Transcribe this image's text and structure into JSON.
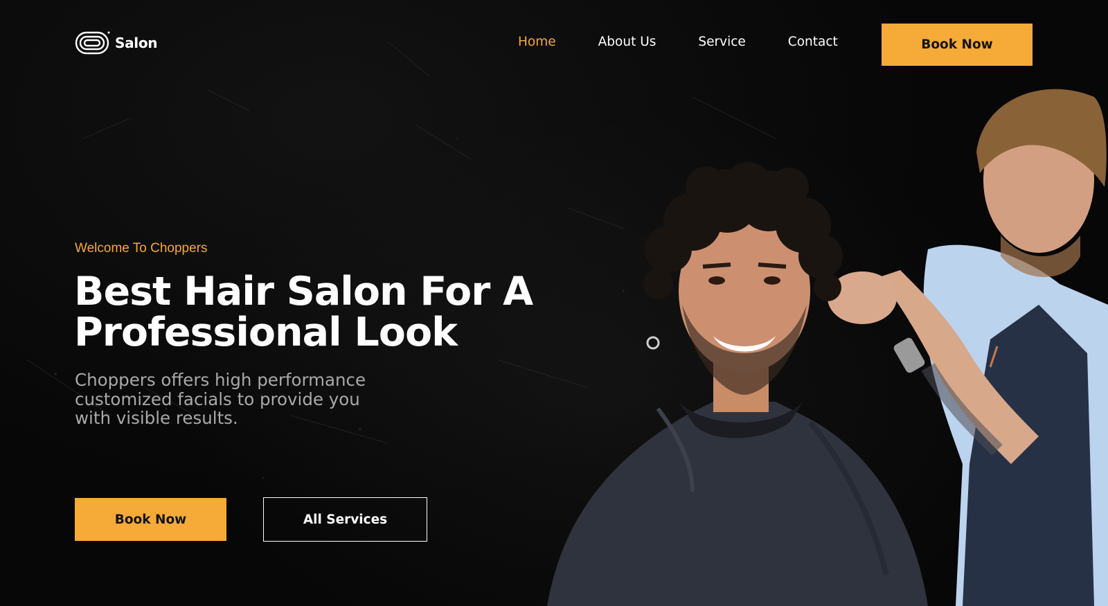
{
  "brand": {
    "name": "Salon",
    "icon": "salon-logo-icon"
  },
  "nav": {
    "items": [
      {
        "label": "Home",
        "active": true
      },
      {
        "label": "About Us",
        "active": false
      },
      {
        "label": "Service",
        "active": false
      },
      {
        "label": "Contact",
        "active": false
      }
    ],
    "cta_label": "Book Now"
  },
  "hero": {
    "eyebrow": "Welcome To Choppers",
    "headline_line1": "Best Hair Salon For A",
    "headline_line2": "Professional Look",
    "sub_line1": "Choppers offers high performance",
    "sub_line2": "customized facials to provide you",
    "sub_line3": "with visible results.",
    "primary_button": "Book Now",
    "secondary_button": "All Services"
  },
  "colors": {
    "accent": "#f6aa38",
    "background": "#070707",
    "text": "#ffffff",
    "muted_text": "#a9a9a9"
  }
}
